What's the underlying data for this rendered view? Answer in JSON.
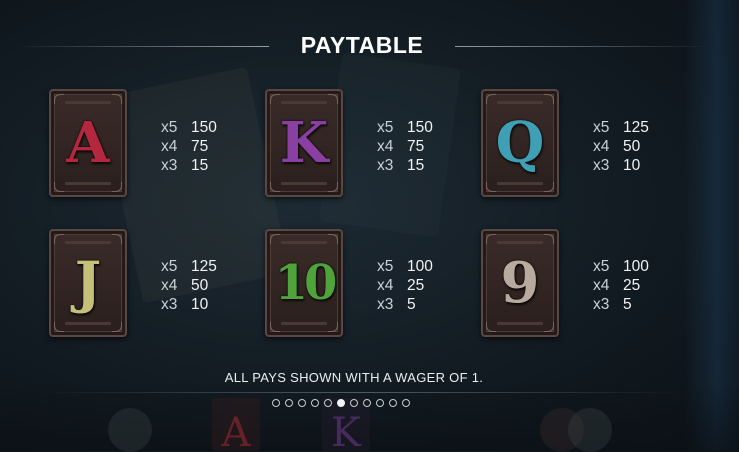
{
  "title": "PAYTABLE",
  "symbols": [
    {
      "glyph": "A",
      "color": "#b3283f",
      "pays": [
        {
          "mult": "x5",
          "value": "150"
        },
        {
          "mult": "x4",
          "value": "75"
        },
        {
          "mult": "x3",
          "value": "15"
        }
      ]
    },
    {
      "glyph": "K",
      "color": "#8a3fa3",
      "pays": [
        {
          "mult": "x5",
          "value": "150"
        },
        {
          "mult": "x4",
          "value": "75"
        },
        {
          "mult": "x3",
          "value": "15"
        }
      ]
    },
    {
      "glyph": "Q",
      "color": "#3fa0b5",
      "pays": [
        {
          "mult": "x5",
          "value": "125"
        },
        {
          "mult": "x4",
          "value": "50"
        },
        {
          "mult": "x3",
          "value": "10"
        }
      ]
    },
    {
      "glyph": "J",
      "color": "#c4c07a",
      "pays": [
        {
          "mult": "x5",
          "value": "125"
        },
        {
          "mult": "x4",
          "value": "50"
        },
        {
          "mult": "x3",
          "value": "10"
        }
      ]
    },
    {
      "glyph": "10",
      "color": "#4ea33a",
      "pays": [
        {
          "mult": "x5",
          "value": "100"
        },
        {
          "mult": "x4",
          "value": "25"
        },
        {
          "mult": "x3",
          "value": "5"
        }
      ]
    },
    {
      "glyph": "9",
      "color": "#b9aaa0",
      "pays": [
        {
          "mult": "x5",
          "value": "100"
        },
        {
          "mult": "x4",
          "value": "25"
        },
        {
          "mult": "x3",
          "value": "5"
        }
      ]
    }
  ],
  "footer_note": "ALL PAYS SHOWN WITH A WAGER OF 1.",
  "pagination": {
    "total": 11,
    "current": 6
  },
  "background_ghost_letters": [
    "A",
    "K"
  ]
}
